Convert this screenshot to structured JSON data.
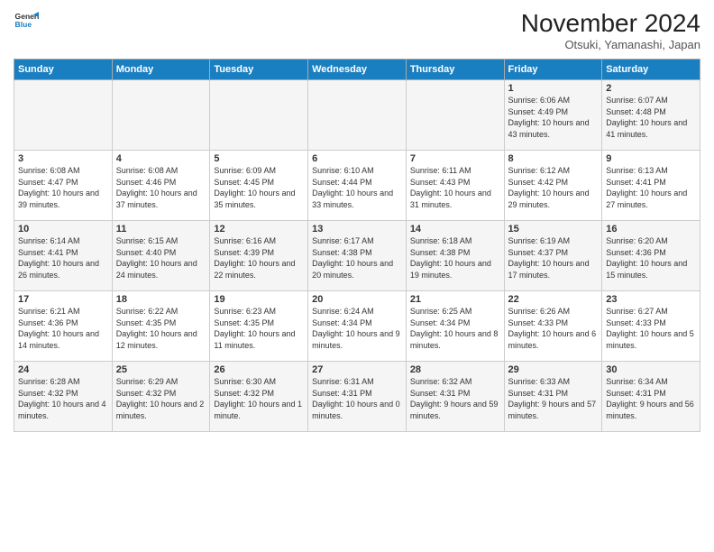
{
  "logo": {
    "line1": "General",
    "line2": "Blue"
  },
  "title": "November 2024",
  "subtitle": "Otsuki, Yamanashi, Japan",
  "days_label": "Daylight hours",
  "headers": [
    "Sunday",
    "Monday",
    "Tuesday",
    "Wednesday",
    "Thursday",
    "Friday",
    "Saturday"
  ],
  "weeks": [
    [
      {
        "day": "",
        "info": ""
      },
      {
        "day": "",
        "info": ""
      },
      {
        "day": "",
        "info": ""
      },
      {
        "day": "",
        "info": ""
      },
      {
        "day": "",
        "info": ""
      },
      {
        "day": "1",
        "info": "Sunrise: 6:06 AM\nSunset: 4:49 PM\nDaylight: 10 hours and 43 minutes."
      },
      {
        "day": "2",
        "info": "Sunrise: 6:07 AM\nSunset: 4:48 PM\nDaylight: 10 hours and 41 minutes."
      }
    ],
    [
      {
        "day": "3",
        "info": "Sunrise: 6:08 AM\nSunset: 4:47 PM\nDaylight: 10 hours and 39 minutes."
      },
      {
        "day": "4",
        "info": "Sunrise: 6:08 AM\nSunset: 4:46 PM\nDaylight: 10 hours and 37 minutes."
      },
      {
        "day": "5",
        "info": "Sunrise: 6:09 AM\nSunset: 4:45 PM\nDaylight: 10 hours and 35 minutes."
      },
      {
        "day": "6",
        "info": "Sunrise: 6:10 AM\nSunset: 4:44 PM\nDaylight: 10 hours and 33 minutes."
      },
      {
        "day": "7",
        "info": "Sunrise: 6:11 AM\nSunset: 4:43 PM\nDaylight: 10 hours and 31 minutes."
      },
      {
        "day": "8",
        "info": "Sunrise: 6:12 AM\nSunset: 4:42 PM\nDaylight: 10 hours and 29 minutes."
      },
      {
        "day": "9",
        "info": "Sunrise: 6:13 AM\nSunset: 4:41 PM\nDaylight: 10 hours and 27 minutes."
      }
    ],
    [
      {
        "day": "10",
        "info": "Sunrise: 6:14 AM\nSunset: 4:41 PM\nDaylight: 10 hours and 26 minutes."
      },
      {
        "day": "11",
        "info": "Sunrise: 6:15 AM\nSunset: 4:40 PM\nDaylight: 10 hours and 24 minutes."
      },
      {
        "day": "12",
        "info": "Sunrise: 6:16 AM\nSunset: 4:39 PM\nDaylight: 10 hours and 22 minutes."
      },
      {
        "day": "13",
        "info": "Sunrise: 6:17 AM\nSunset: 4:38 PM\nDaylight: 10 hours and 20 minutes."
      },
      {
        "day": "14",
        "info": "Sunrise: 6:18 AM\nSunset: 4:38 PM\nDaylight: 10 hours and 19 minutes."
      },
      {
        "day": "15",
        "info": "Sunrise: 6:19 AM\nSunset: 4:37 PM\nDaylight: 10 hours and 17 minutes."
      },
      {
        "day": "16",
        "info": "Sunrise: 6:20 AM\nSunset: 4:36 PM\nDaylight: 10 hours and 15 minutes."
      }
    ],
    [
      {
        "day": "17",
        "info": "Sunrise: 6:21 AM\nSunset: 4:36 PM\nDaylight: 10 hours and 14 minutes."
      },
      {
        "day": "18",
        "info": "Sunrise: 6:22 AM\nSunset: 4:35 PM\nDaylight: 10 hours and 12 minutes."
      },
      {
        "day": "19",
        "info": "Sunrise: 6:23 AM\nSunset: 4:35 PM\nDaylight: 10 hours and 11 minutes."
      },
      {
        "day": "20",
        "info": "Sunrise: 6:24 AM\nSunset: 4:34 PM\nDaylight: 10 hours and 9 minutes."
      },
      {
        "day": "21",
        "info": "Sunrise: 6:25 AM\nSunset: 4:34 PM\nDaylight: 10 hours and 8 minutes."
      },
      {
        "day": "22",
        "info": "Sunrise: 6:26 AM\nSunset: 4:33 PM\nDaylight: 10 hours and 6 minutes."
      },
      {
        "day": "23",
        "info": "Sunrise: 6:27 AM\nSunset: 4:33 PM\nDaylight: 10 hours and 5 minutes."
      }
    ],
    [
      {
        "day": "24",
        "info": "Sunrise: 6:28 AM\nSunset: 4:32 PM\nDaylight: 10 hours and 4 minutes."
      },
      {
        "day": "25",
        "info": "Sunrise: 6:29 AM\nSunset: 4:32 PM\nDaylight: 10 hours and 2 minutes."
      },
      {
        "day": "26",
        "info": "Sunrise: 6:30 AM\nSunset: 4:32 PM\nDaylight: 10 hours and 1 minute."
      },
      {
        "day": "27",
        "info": "Sunrise: 6:31 AM\nSunset: 4:31 PM\nDaylight: 10 hours and 0 minutes."
      },
      {
        "day": "28",
        "info": "Sunrise: 6:32 AM\nSunset: 4:31 PM\nDaylight: 9 hours and 59 minutes."
      },
      {
        "day": "29",
        "info": "Sunrise: 6:33 AM\nSunset: 4:31 PM\nDaylight: 9 hours and 57 minutes."
      },
      {
        "day": "30",
        "info": "Sunrise: 6:34 AM\nSunset: 4:31 PM\nDaylight: 9 hours and 56 minutes."
      }
    ]
  ]
}
